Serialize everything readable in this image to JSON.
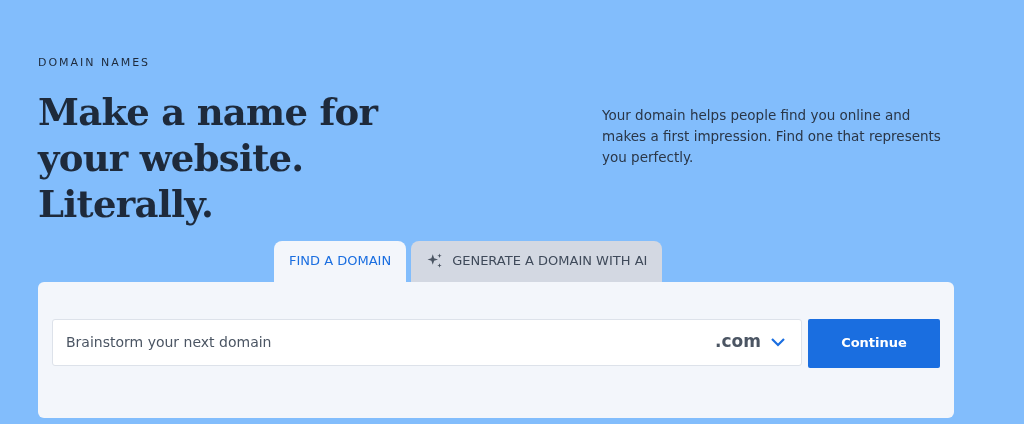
{
  "eyebrow": "DOMAIN NAMES",
  "headline": "Make a name for your website. Literally.",
  "intro": "Your domain helps people find you online and makes a first impression. Find one that represents you perfectly.",
  "tabs": [
    {
      "label": "FIND A DOMAIN",
      "selected": true,
      "kind": "plain"
    },
    {
      "label": "GENERATE A DOMAIN WITH AI",
      "selected": false,
      "kind": "ai"
    }
  ],
  "search": {
    "placeholder": "Brainstorm your next domain",
    "extension": ".com"
  },
  "button": "Continue"
}
